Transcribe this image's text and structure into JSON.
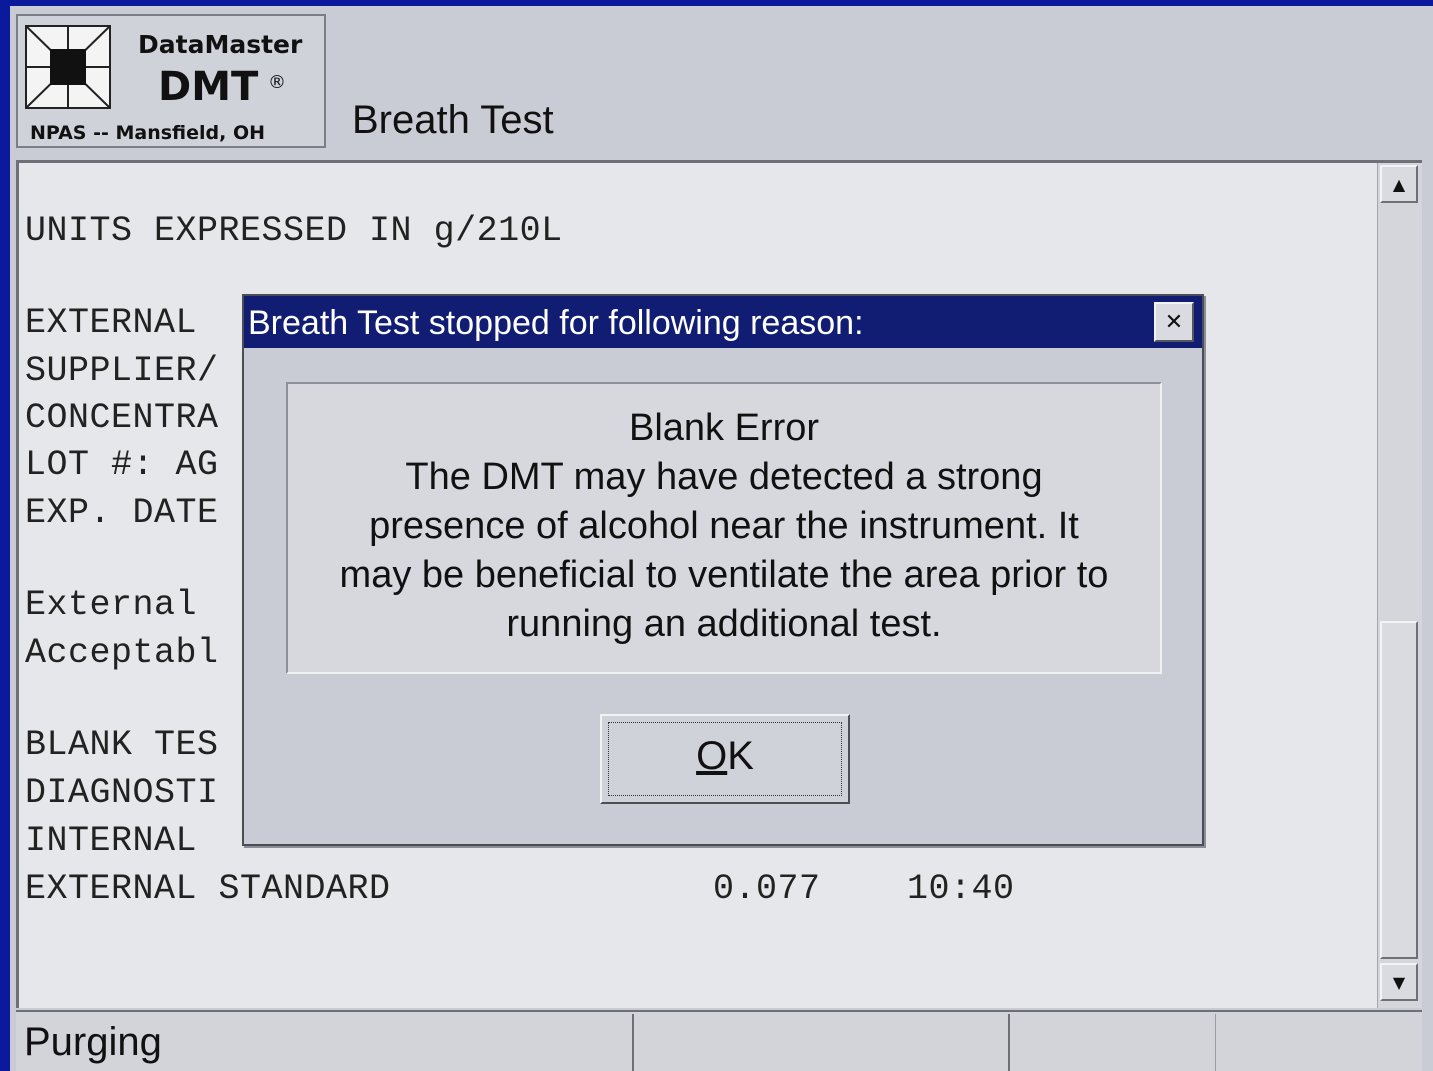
{
  "header": {
    "logo_brand": "DataMaster",
    "logo_product": "DMT",
    "logo_registered": "®",
    "logo_location": "NPAS -- Mansfield, OH",
    "window_title": "Breath Test"
  },
  "report": {
    "lines": [
      "UNITS EXPRESSED IN g/210L",
      "EXTERNAL",
      "SUPPLIER/",
      "CONCENTRA",
      "LOT #: AG",
      "EXP. DATE",
      "External",
      "Acceptabl",
      "BLANK TES",
      "DIAGNOSTI",
      "INTERNAL",
      "EXTERNAL STANDARD"
    ],
    "external_standard_value": "0.077",
    "external_standard_time": "10:40"
  },
  "dialog": {
    "title": "Breath Test stopped for following reason:",
    "close_glyph": "✕",
    "message_lines": [
      "Blank Error",
      "The DMT may have detected a strong",
      "presence of alcohol near the instrument. It",
      "may be beneficial to ventilate the area prior to",
      "running an additional test."
    ],
    "ok_label": "OK"
  },
  "status_bar": {
    "status_text": "Purging"
  },
  "scrollbar": {
    "up_icon": "▲",
    "down_icon": "▼"
  }
}
